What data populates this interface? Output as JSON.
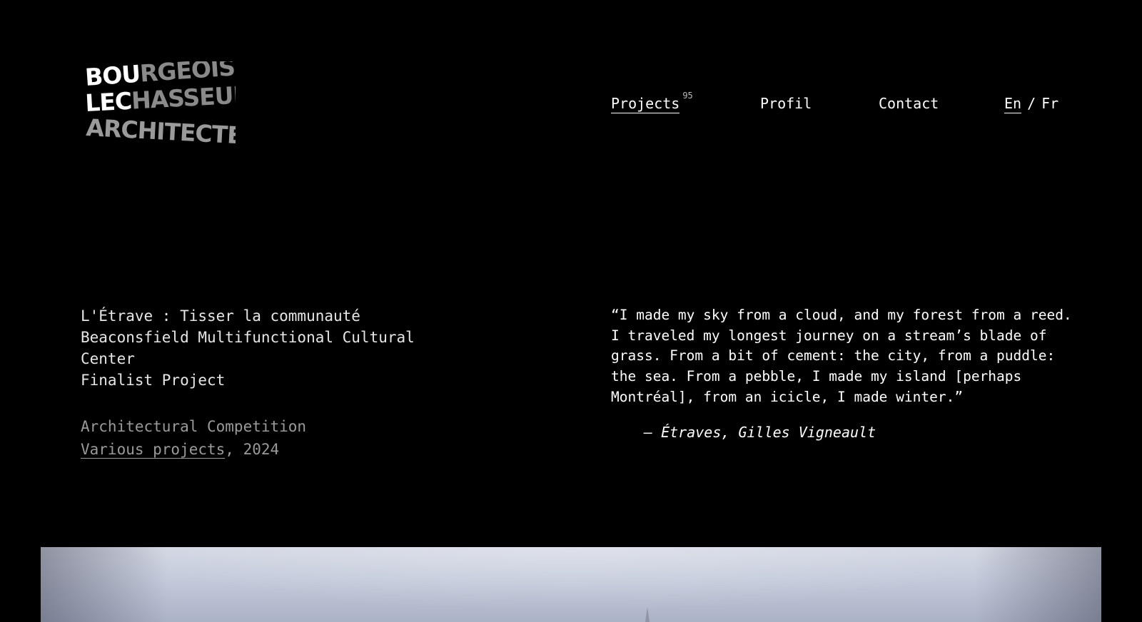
{
  "logo": {
    "lines": [
      "BOURGEOIS /",
      "LECHASSEUR",
      "ARCHITECTES"
    ]
  },
  "nav": {
    "projects_label": "Projects",
    "projects_count": "95",
    "profil_label": "Profil",
    "contact_label": "Contact",
    "lang_en": "En",
    "lang_sep": "/",
    "lang_fr": "Fr"
  },
  "project": {
    "title_lines": [
      "L'Étrave : Tisser la communauté",
      "Beaconsfield Multifunctional Cultural",
      "Center",
      "Finalist Project"
    ],
    "category": "Architectural Competition",
    "collection_link": "Various projects",
    "year_suffix": ", 2024"
  },
  "quote": {
    "lines": [
      "“I made my sky from a cloud, and my forest from a reed.",
      "I traveled my longest journey on a stream’s blade of",
      "grass. From a bit of cement: the city, from a puddle:",
      "the sea. From a pebble, I made my island [perhaps",
      "Montréal], from an icicle, I made winter.”"
    ],
    "attribution": "– Étraves, Gilles Vigneault"
  },
  "colors": {
    "background": "#000000",
    "text": "#ffffff",
    "muted": "#9a9a9a",
    "logo_gray": "#8a8a8a"
  }
}
